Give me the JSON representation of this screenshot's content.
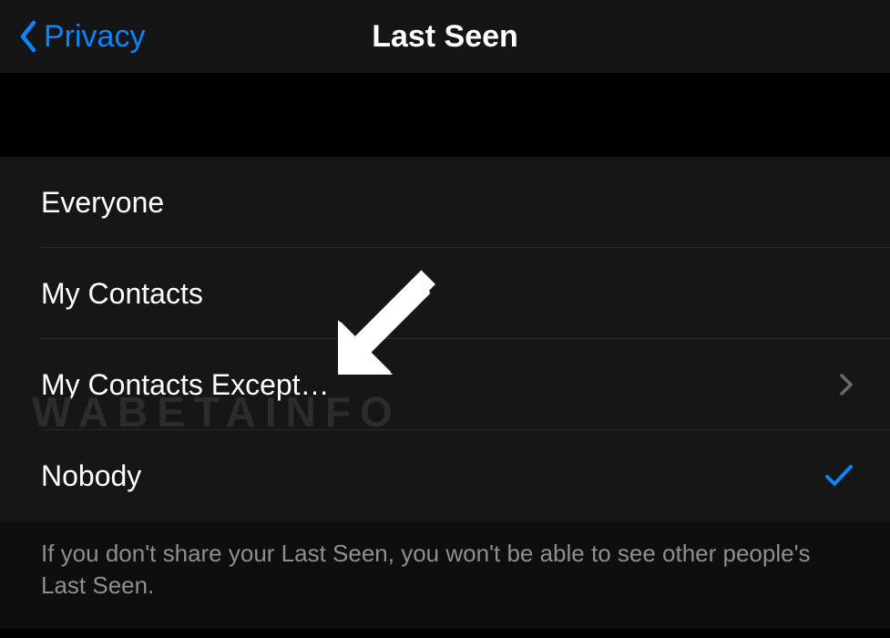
{
  "nav": {
    "back_label": "Privacy",
    "title": "Last Seen"
  },
  "options": {
    "everyone": "Everyone",
    "my_contacts": "My Contacts",
    "my_contacts_except": "My Contacts Except…",
    "nobody": "Nobody"
  },
  "footer": "If you don't share your Last Seen, you won't be able to see other people's Last Seen.",
  "watermark": "WABETAINFO",
  "selected": "nobody"
}
